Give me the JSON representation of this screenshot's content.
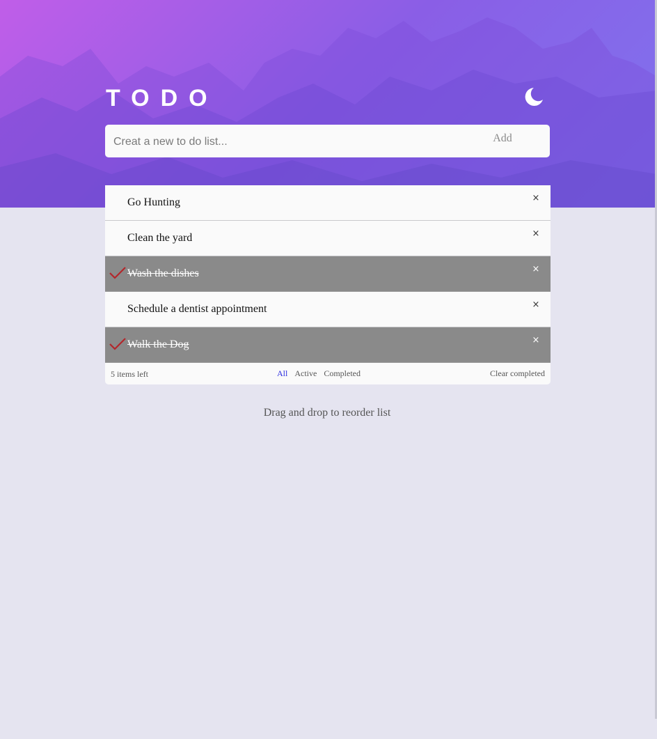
{
  "header": {
    "title": "TODO",
    "theme_icon": "moon-icon"
  },
  "new_todo": {
    "placeholder": "Creat a new to do list...",
    "value": "",
    "add_label": "Add"
  },
  "todos": [
    {
      "text": "Go Hunting",
      "completed": false
    },
    {
      "text": "Clean the yard",
      "completed": false
    },
    {
      "text": "Wash the dishes",
      "completed": true
    },
    {
      "text": "Schedule a dentist appointment",
      "completed": false
    },
    {
      "text": "Walk the Dog",
      "completed": true
    }
  ],
  "remove_glyph": "×",
  "footer": {
    "items_left": "5 items left",
    "filters": [
      "All",
      "Active",
      "Completed"
    ],
    "active_filter": "All",
    "clear_label": "Clear completed"
  },
  "hint": "Drag and drop to reorder list",
  "colors": {
    "gradient_start": "#c05ee8",
    "gradient_end": "#7f74ee",
    "completed_bg": "#8a8a8a",
    "check_color": "#b3262b",
    "active_filter": "#2d2ee0",
    "page_bg": "#e5e4f0"
  }
}
